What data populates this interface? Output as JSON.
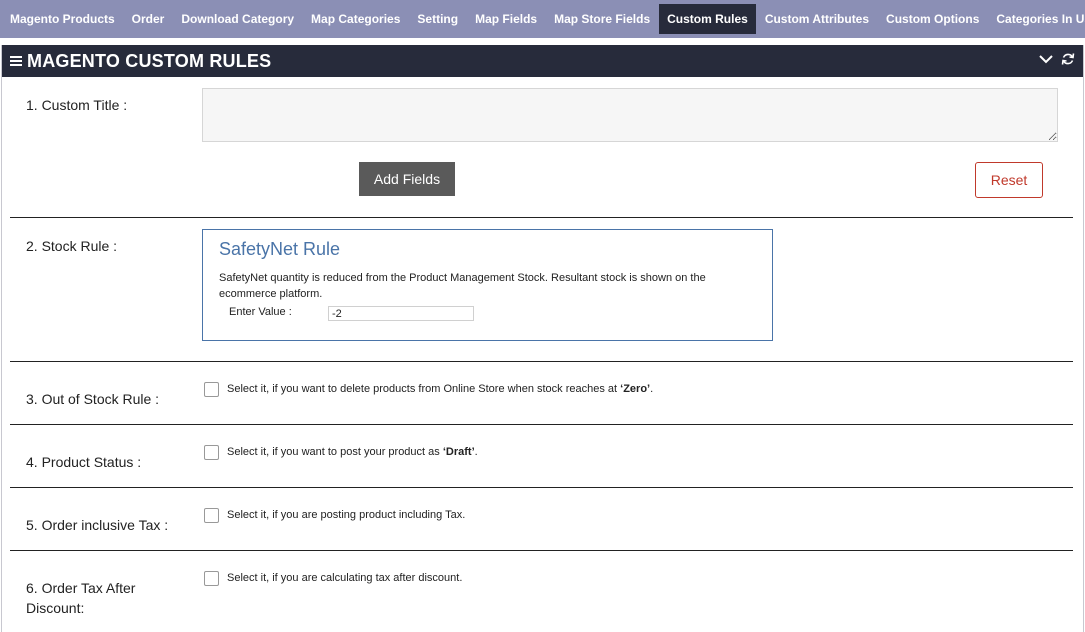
{
  "tabs": [
    {
      "label": "Magento Products",
      "active": false
    },
    {
      "label": "Order",
      "active": false
    },
    {
      "label": "Download Category",
      "active": false
    },
    {
      "label": "Map Categories",
      "active": false
    },
    {
      "label": "Setting",
      "active": false
    },
    {
      "label": "Map Fields",
      "active": false
    },
    {
      "label": "Map Store Fields",
      "active": false
    },
    {
      "label": "Custom Rules",
      "active": true
    },
    {
      "label": "Custom Attributes",
      "active": false
    },
    {
      "label": "Custom Options",
      "active": false
    },
    {
      "label": "Categories In Use",
      "active": false
    }
  ],
  "panel": {
    "title": "MAGENTO CUSTOM RULES",
    "icons": [
      "menu-icon",
      "chevron-down-icon",
      "refresh-icon"
    ]
  },
  "custom_title": {
    "label": "1. Custom Title :",
    "value": ""
  },
  "buttons": {
    "add_fields": "Add Fields",
    "reset": "Reset"
  },
  "stock_rule": {
    "label": "2. Stock Rule :",
    "box_title": "SafetyNet Rule",
    "description": "SafetyNet quantity is reduced from the Product Management Stock. Resultant stock is shown on the ecommerce platform.",
    "enter_value_label": "Enter Value :",
    "value": "-2"
  },
  "rules": [
    {
      "label": "3. Out of Stock Rule :",
      "text_before": "Select it, if you want to delete products from Online Store when stock reaches at ",
      "emphasis": "‘Zero’",
      "text_after": ".",
      "checked": false
    },
    {
      "label": "4. Product Status :",
      "text_before": "Select it, if you want to post your product as ",
      "emphasis": "‘Draft’",
      "text_after": ".",
      "checked": false
    },
    {
      "label": "5. Order inclusive Tax :",
      "text_before": "Select it, if you are posting product including Tax.",
      "emphasis": "",
      "text_after": "",
      "checked": false
    },
    {
      "label_line1": "6. Order Tax After",
      "label_line2": "Discount:",
      "text_before": "Select it, if you are calculating tax after discount.",
      "emphasis": "",
      "text_after": "",
      "checked": false
    }
  ],
  "colors": {
    "tabbar_bg": "#8b8fb5",
    "active_tab_bg": "#272b3b",
    "header_bg": "#272b3b",
    "accent_blue": "#4a74a8",
    "reset_red": "#c0392b",
    "add_button_bg": "#5a5a5a"
  }
}
